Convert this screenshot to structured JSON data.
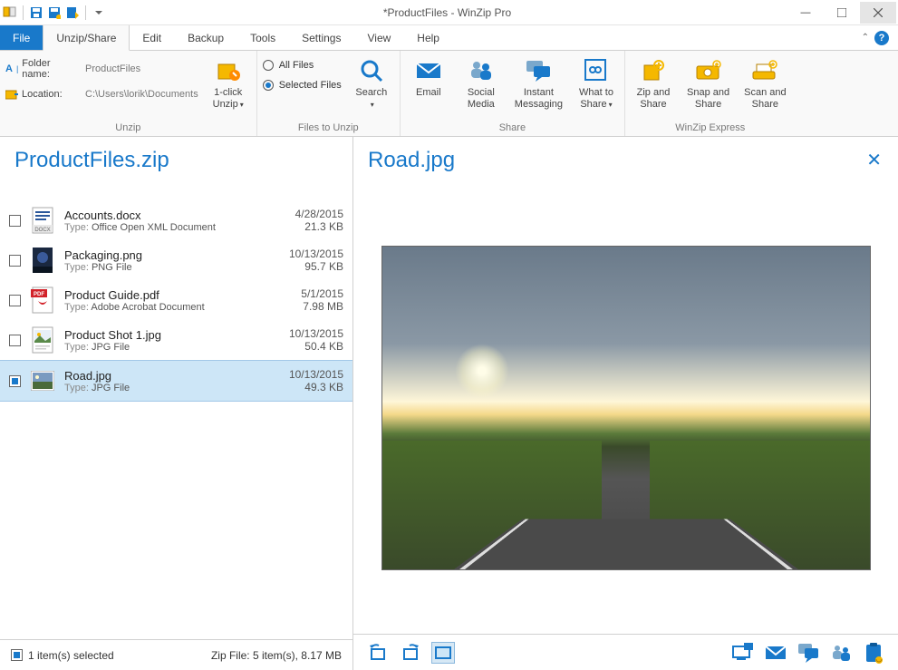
{
  "title": "*ProductFiles - WinZip Pro",
  "tabs": {
    "file": "File",
    "items": [
      "Unzip/Share",
      "Edit",
      "Backup",
      "Tools",
      "Settings",
      "View",
      "Help"
    ],
    "active": 0
  },
  "ribbon": {
    "unzip": {
      "folder_label": "Folder name:",
      "folder_value": "ProductFiles",
      "location_label": "Location:",
      "location_value": "C:\\Users\\lorik\\Documents",
      "one_click": "1-click\nUnzip",
      "group": "Unzip"
    },
    "files_to_unzip": {
      "all": "All Files",
      "selected": "Selected Files",
      "search": "Search",
      "group": "Files to Unzip"
    },
    "share": {
      "email": "Email",
      "social": "Social\nMedia",
      "im": "Instant\nMessaging",
      "what": "What to\nShare",
      "group": "Share"
    },
    "express": {
      "zip": "Zip and\nShare",
      "snap": "Snap and\nShare",
      "scan": "Scan and\nShare",
      "group": "WinZip Express"
    }
  },
  "archive_name": "ProductFiles.zip",
  "files": [
    {
      "name": "Accounts.docx",
      "type": "Office Open XML Document",
      "date": "4/28/2015",
      "size": "21.3 KB",
      "icon": "docx",
      "selected": false
    },
    {
      "name": "Packaging.png",
      "type": "PNG File",
      "date": "10/13/2015",
      "size": "95.7 KB",
      "icon": "png",
      "selected": false
    },
    {
      "name": "Product Guide.pdf",
      "type": "Adobe Acrobat Document",
      "date": "5/1/2015",
      "size": "7.98 MB",
      "icon": "pdf",
      "selected": false
    },
    {
      "name": "Product Shot 1.jpg",
      "type": "JPG File",
      "date": "10/13/2015",
      "size": "50.4 KB",
      "icon": "jpg",
      "selected": false
    },
    {
      "name": "Road.jpg",
      "type": "JPG File",
      "date": "10/13/2015",
      "size": "49.3 KB",
      "icon": "photo",
      "selected": true
    }
  ],
  "status": {
    "selected": "1 item(s) selected",
    "summary": "Zip File: 5 item(s), 8.17 MB"
  },
  "preview": {
    "title": "Road.jpg"
  },
  "type_label": "Type:"
}
